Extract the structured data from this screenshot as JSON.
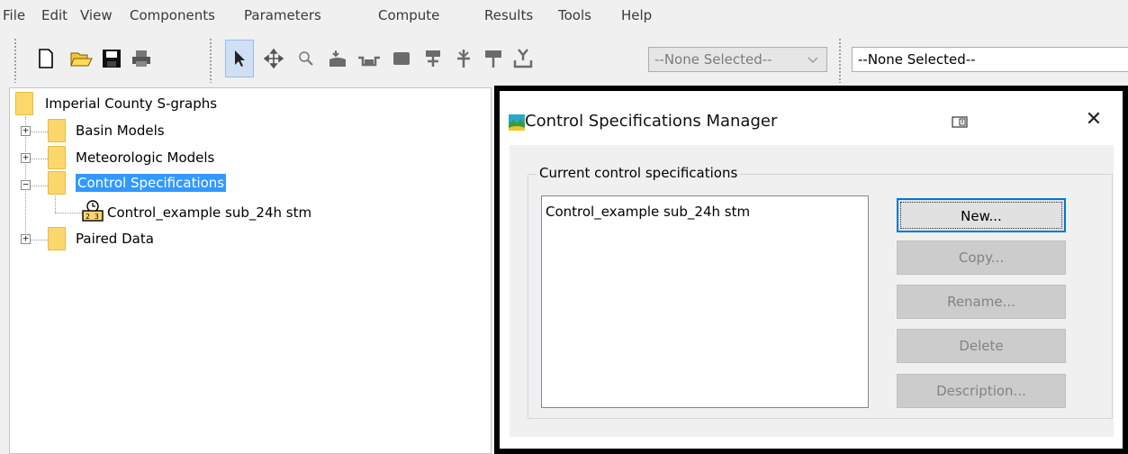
{
  "menu": [
    "File",
    "Edit",
    "View",
    "Components",
    "Parameters",
    "Compute",
    "Results",
    "Tools",
    "Help"
  ],
  "toolbar": {
    "combo_1_value": "--None Selected--",
    "combo_2_value": "--None Selected--"
  },
  "tree": {
    "root": "Imperial County S-graphs",
    "items": [
      "Basin Models",
      "Meteorologic Models",
      "Control Specifications",
      "Paired Data"
    ],
    "child": "Control_example sub_24h stm"
  },
  "dialog": {
    "title": "Control Specifications Manager",
    "group_label": "Current control specifications",
    "list_items": [
      "Control_example sub_24h stm"
    ],
    "buttons": {
      "new": "New...",
      "copy": "Copy...",
      "rename": "Rename...",
      "delete": "Delete",
      "description": "Description..."
    }
  },
  "colors": {
    "selection": "#3399ff",
    "folder": "#fcd76b",
    "focus_border": "#0078d7"
  }
}
